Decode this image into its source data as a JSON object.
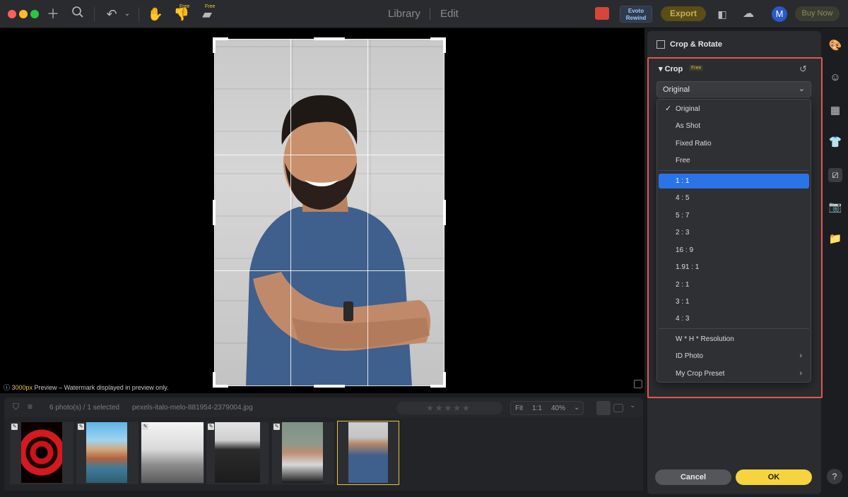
{
  "titlebar": {
    "tabs": [
      {
        "label": "Library"
      },
      {
        "label": "Edit"
      }
    ],
    "free_label": "Free",
    "rewind_label": "Evoto Rewind",
    "export_label": "Export",
    "avatar_initial": "M",
    "buy_label": "Buy Now"
  },
  "canvas": {
    "preview_size": "3000px",
    "preview_note": " Preview – Watermark displayed in preview only."
  },
  "filmstrip": {
    "selection_count": "6 photo(s) / 1 selected",
    "filename": "pexels-italo-melo-881954-2379004.jpg",
    "fit_label": "Fit",
    "one_to_one": "1:1",
    "zoom_value": "40%",
    "thumbnails": [
      {
        "name": "spiral-staircase"
      },
      {
        "name": "canal-buildings"
      },
      {
        "name": "corridor-stairs"
      },
      {
        "name": "man-in-suit"
      },
      {
        "name": "woman-portrait"
      },
      {
        "name": "man-blue-shirt",
        "selected": true
      }
    ]
  },
  "panel": {
    "title": "Crop & Rotate",
    "section": "Crop",
    "section_tag": "Free",
    "select_value": "Original",
    "menu_items": [
      {
        "label": "Original",
        "checked": true
      },
      {
        "label": "As Shot"
      },
      {
        "label": "Fixed Ratio"
      },
      {
        "label": "Free"
      },
      {
        "label": "1 : 1",
        "highlighted": true
      },
      {
        "label": "4 : 5"
      },
      {
        "label": "5 : 7"
      },
      {
        "label": "2 : 3"
      },
      {
        "label": "16 : 9"
      },
      {
        "label": "1.91 : 1"
      },
      {
        "label": "2 : 1"
      },
      {
        "label": "3 : 1"
      },
      {
        "label": "4 : 3"
      },
      {
        "label": "W * H * Resolution"
      },
      {
        "label": "ID Photo",
        "submenu": true
      },
      {
        "label": "My Crop Preset",
        "submenu": true
      }
    ],
    "cancel_label": "Cancel",
    "ok_label": "OK"
  },
  "rail": {
    "items": [
      {
        "icon": "palette-icon"
      },
      {
        "icon": "face-icon"
      },
      {
        "icon": "background-icon"
      },
      {
        "icon": "clothing-icon"
      },
      {
        "icon": "crop-rotate-icon",
        "active": true
      },
      {
        "icon": "camera-icon"
      },
      {
        "icon": "folder-preview-icon"
      }
    ],
    "help_label": "?"
  },
  "colors": {
    "accent_yellow": "#f5d43d",
    "selection_blue": "#2b74e8",
    "highlight_red": "#e05656"
  }
}
